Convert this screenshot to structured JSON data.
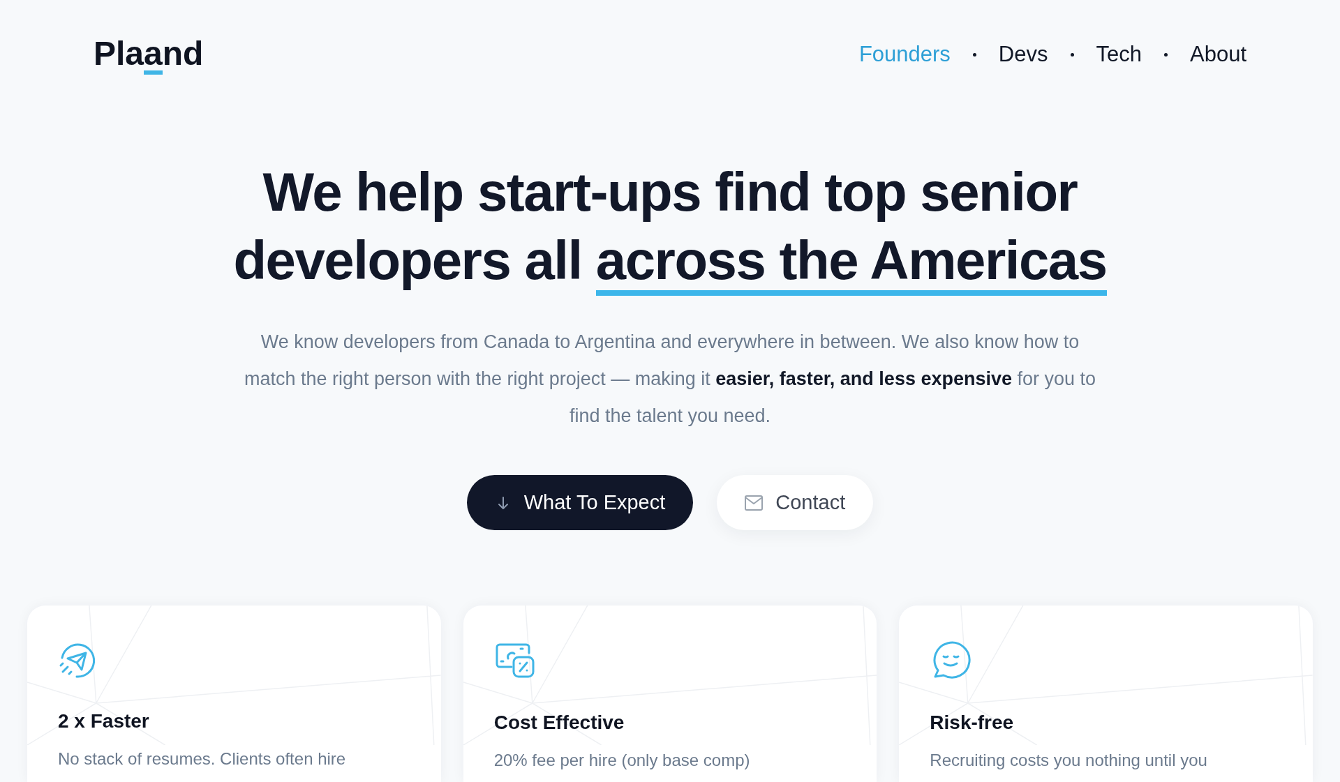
{
  "logo": {
    "before": "Pla",
    "accent": "a",
    "after": "nd"
  },
  "nav": [
    {
      "label": "Founders",
      "selected": true
    },
    {
      "label": "Devs",
      "selected": false
    },
    {
      "label": "Tech",
      "selected": false
    },
    {
      "label": "About",
      "selected": false
    }
  ],
  "hero": {
    "headline": "We help start-ups find top senior developers all",
    "highlight": "across the Americas",
    "paragraph": "We know developers from Canada to Argentina and everywhere in between. We also know how to match the right person with the right project — making it **easier, faster, and less expensive** for you to find the talent you need."
  },
  "buttons": [
    {
      "label": "What To Expect",
      "kind": "primary"
    },
    {
      "label": "Contact",
      "kind": "secondary"
    }
  ],
  "cards": [
    {
      "kind": "rocket",
      "title": "2 x Faster",
      "text": "No stack of resumes. Clients often hire"
    },
    {
      "kind": "money",
      "title": "Cost Effective",
      "text": "20% fee per hire (only base comp)"
    },
    {
      "kind": "smile",
      "title": "Risk-free",
      "text": "Recruiting costs you nothing until you"
    }
  ]
}
